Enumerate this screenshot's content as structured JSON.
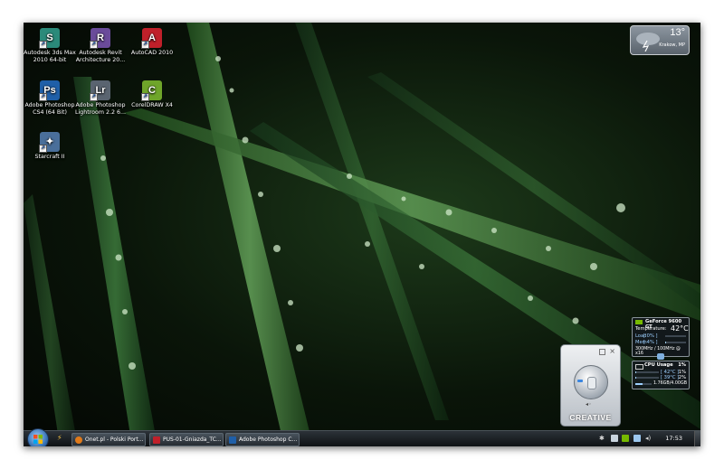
{
  "desktop": {
    "icons": [
      {
        "label_line1": "Autodesk 3ds Max",
        "label_line2": "2010 64-bit",
        "icon": "3ds-max-icon",
        "color": "#2b8a7a",
        "glyph": "S"
      },
      {
        "label_line1": "Autodesk Revit",
        "label_line2": "Architecture 20...",
        "icon": "revit-icon",
        "color": "#6a4b9a",
        "glyph": "R"
      },
      {
        "label_line1": "AutoCAD 2010",
        "label_line2": "",
        "icon": "autocad-icon",
        "color": "#c0202a",
        "glyph": "A"
      },
      {
        "label_line1": "Adobe Photoshop",
        "label_line2": "CS4 (64 Bit)",
        "icon": "photoshop-icon",
        "color": "#1f5fa8",
        "glyph": "Ps"
      },
      {
        "label_line1": "Adobe Photoshop",
        "label_line2": "Lightroom 2.2 6...",
        "icon": "lightroom-icon",
        "color": "#5a6470",
        "glyph": "Lr"
      },
      {
        "label_line1": "CorelDRAW X4",
        "label_line2": "",
        "icon": "coreldraw-icon",
        "color": "#6fa52a",
        "glyph": "C"
      },
      {
        "label_line1": "Starcraft II",
        "label_line2": "",
        "icon": "starcraft-icon",
        "color": "#4a6f9a",
        "glyph": "✦"
      }
    ]
  },
  "weather": {
    "temperature": "13°",
    "location": "Krakow, MP"
  },
  "gpu_gadget": {
    "title": "GeForce 9600 GT",
    "temp_label": "Temperature:",
    "temp_value": "42°C",
    "load_label": "Load",
    "load_value": "[ 0% ]",
    "mem_label": "Mem",
    "mem_value": "[ 4% ]",
    "clocks": "300MHz / 100MHz @ x16",
    "load_fraction": 0.0,
    "mem_fraction": 0.04
  },
  "cpu_gadget": {
    "title": "CPU Usage",
    "total": "1%",
    "core1_temp": "[ 42°C ]",
    "core1_usage": "1%",
    "core2_temp": "[ 39°C ]",
    "core2_usage": "2%",
    "memory": "1.76GB/4.00GB",
    "core1_fraction": 0.01,
    "core2_fraction": 0.02,
    "memory_fraction": 0.44
  },
  "creative_widget": {
    "brand": "CREATIVE"
  },
  "taskbar": {
    "buttons": [
      {
        "label": "Onet.pl - Polski Port...",
        "icon": "firefox-icon",
        "color": "#e07a1a"
      },
      {
        "label": "PUS-01-Gniazda_TC...",
        "icon": "pdf-icon",
        "color": "#c0202a"
      },
      {
        "label": "Adobe Photoshop C...",
        "icon": "photoshop-icon",
        "color": "#1f5fa8"
      }
    ],
    "clock": "17:53"
  }
}
